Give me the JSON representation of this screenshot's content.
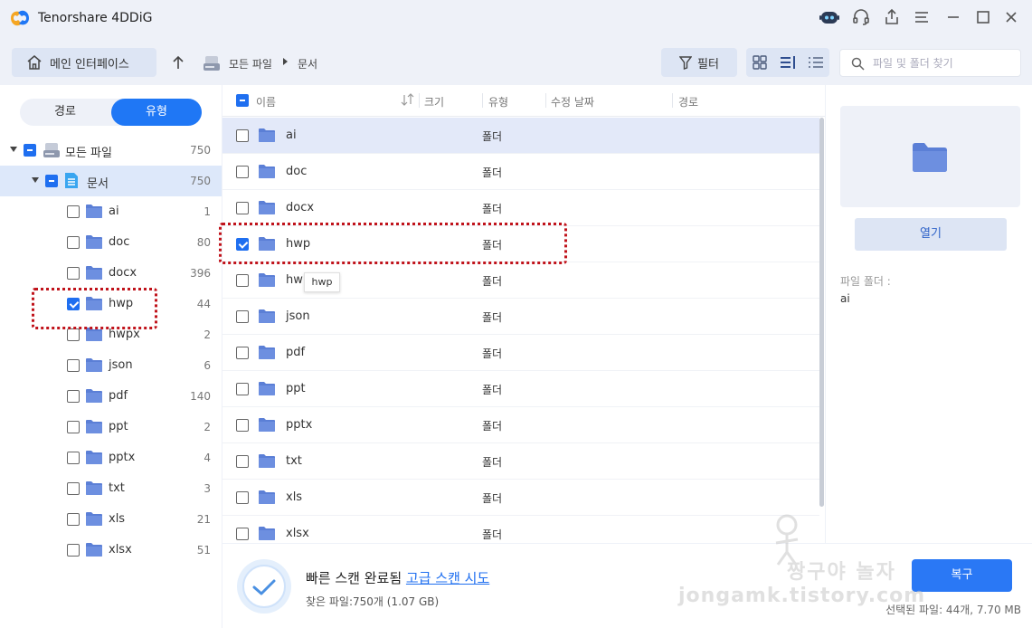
{
  "app": {
    "title": "Tenorshare 4DDiG",
    "logo_icon": "4ddig-logo-icon",
    "window_buttons": [
      "robot-assistant-icon",
      "headset-icon",
      "share-icon",
      "menu-icon",
      "minimize-icon",
      "maximize-icon",
      "close-icon"
    ]
  },
  "toolbar": {
    "home_label": "메인 인터페이스",
    "breadcrumb": [
      "모든 파일",
      "문서"
    ],
    "filter_label": "필터",
    "search_placeholder": "파일 및 폴더 찾기",
    "search_value": "",
    "active_view": "list"
  },
  "left_panel": {
    "toggle": [
      "경로",
      "유형"
    ],
    "active_toggle": "유형",
    "root": {
      "label": "모든 파일",
      "count": "750",
      "state": "partial"
    },
    "category": {
      "label": "문서",
      "count": "750",
      "state": "partial"
    },
    "items": [
      {
        "label": "ai",
        "count": "1",
        "checked": false
      },
      {
        "label": "doc",
        "count": "80",
        "checked": false
      },
      {
        "label": "docx",
        "count": "396",
        "checked": false
      },
      {
        "label": "hwp",
        "count": "44",
        "checked": true
      },
      {
        "label": "hwpx",
        "count": "2",
        "checked": false
      },
      {
        "label": "json",
        "count": "6",
        "checked": false
      },
      {
        "label": "pdf",
        "count": "140",
        "checked": false
      },
      {
        "label": "ppt",
        "count": "2",
        "checked": false
      },
      {
        "label": "pptx",
        "count": "4",
        "checked": false
      },
      {
        "label": "txt",
        "count": "3",
        "checked": false
      },
      {
        "label": "xls",
        "count": "21",
        "checked": false
      },
      {
        "label": "xlsx",
        "count": "51",
        "checked": false
      }
    ]
  },
  "table": {
    "columns": [
      "이름",
      "크기",
      "유형",
      "수정 날짜",
      "경로"
    ],
    "header_check_state": "partial",
    "rows": [
      {
        "name": "ai",
        "type": "폴더",
        "checked": false
      },
      {
        "name": "doc",
        "type": "폴더",
        "checked": false
      },
      {
        "name": "docx",
        "type": "폴더",
        "checked": false
      },
      {
        "name": "hwp",
        "type": "폴더",
        "checked": true
      },
      {
        "name": "hwpx",
        "type": "폴더",
        "checked": false
      },
      {
        "name": "json",
        "type": "폴더",
        "checked": false
      },
      {
        "name": "pdf",
        "type": "폴더",
        "checked": false
      },
      {
        "name": "ppt",
        "type": "폴더",
        "checked": false
      },
      {
        "name": "pptx",
        "type": "폴더",
        "checked": false
      },
      {
        "name": "txt",
        "type": "폴더",
        "checked": false
      },
      {
        "name": "xls",
        "type": "폴더",
        "checked": false
      },
      {
        "name": "xlsx",
        "type": "폴더",
        "checked": false
      }
    ],
    "highlighted_row": "ai",
    "tooltip": "hwp"
  },
  "right_panel": {
    "open_label": "열기",
    "meta_label": "파일 폴더 :",
    "meta_value": "ai"
  },
  "bottom": {
    "status": "빠른 스캔 완료됨",
    "deep_scan_link": "고급 스캔 시도",
    "found": "찾은 파일:750개 (1.07 GB)",
    "recover_label": "복구",
    "selected": "선택된 파일: 44개, 7.70 MB"
  },
  "watermark": {
    "line1": "짱구야 놀자",
    "line2": "jongamk.tistory.com"
  },
  "colors": {
    "accent": "#1f77f5",
    "selected_row": "#e3e9f9",
    "folder": "#5b7fd6",
    "highlight_box": "#c0131b"
  }
}
